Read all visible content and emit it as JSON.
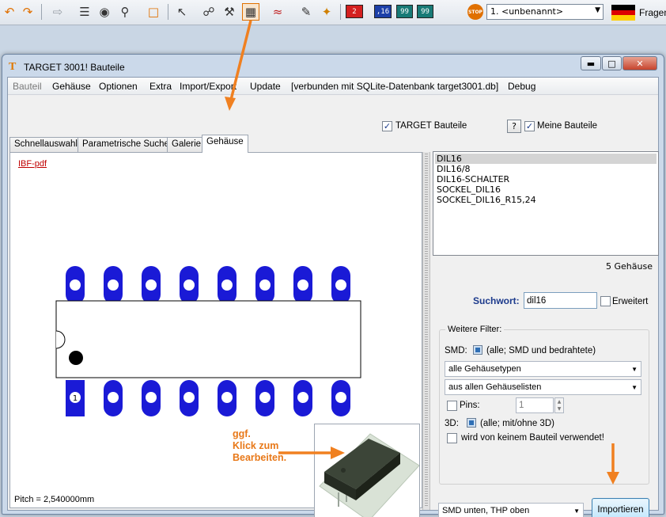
{
  "toolbar": {
    "page_number": "2",
    "badge_16": ",16",
    "badge_99a": "99",
    "badge_99b": "99",
    "stop_text": "STOP",
    "layer_value": "1. <unbenannt>",
    "help_label": "Fragen",
    "accent_colors": {
      "red_box": "#d42020",
      "blue_box": "#1c3fa8",
      "teal_box": "#187a76"
    }
  },
  "window": {
    "title": "TARGET 3001! Bauteile",
    "menu": [
      "Bauteil",
      "Gehäuse",
      "Optionen",
      "Extra",
      "Import/Export",
      "Update",
      "[verbunden mit SQLite-Datenbank target3001.db]",
      "Debug"
    ],
    "target_bauteile_label": "TARGET Bauteile",
    "help_button": "?",
    "meine_bauteile_label": "Meine Bauteile",
    "tabs": [
      "Schnellauswahl",
      "Parametrische Suche",
      "Galerie",
      "Gehäuse"
    ],
    "active_tab": "Gehäuse"
  },
  "preview": {
    "pdf_link": "IBF-pdf",
    "pin_one_label": "1",
    "pitch": "Pitch = 2,540000mm",
    "annotation_lines": [
      "ggf.",
      "Klick zum",
      "Bearbeiten."
    ]
  },
  "packages": {
    "items": [
      "DIL16",
      "DIL16/8",
      "DIL16-SCHALTER",
      "SOCKEL_DIL16",
      "SOCKEL_DIL16_R15,24"
    ],
    "selected": "DIL16",
    "count_text": "5 Gehäuse"
  },
  "search": {
    "label": "Suchwort:",
    "value": "dil16",
    "extended_label": "Erweitert"
  },
  "filters": {
    "title": "Weitere Filter:",
    "smd_label": "SMD:",
    "smd_text": "(alle; SMD und bedrahtete)",
    "type_select": "alle Gehäusetypen",
    "list_select": "aus allen Gehäuselisten",
    "pins_label": "Pins:",
    "pins_value": "1",
    "label_3d": "3D:",
    "text_3d": "(alle; mit/ohne 3D)",
    "unused_label": "wird von keinem Bauteil verwendet!"
  },
  "bottom": {
    "placement_select": "SMD unten, THP oben",
    "import_button": "Importieren"
  }
}
